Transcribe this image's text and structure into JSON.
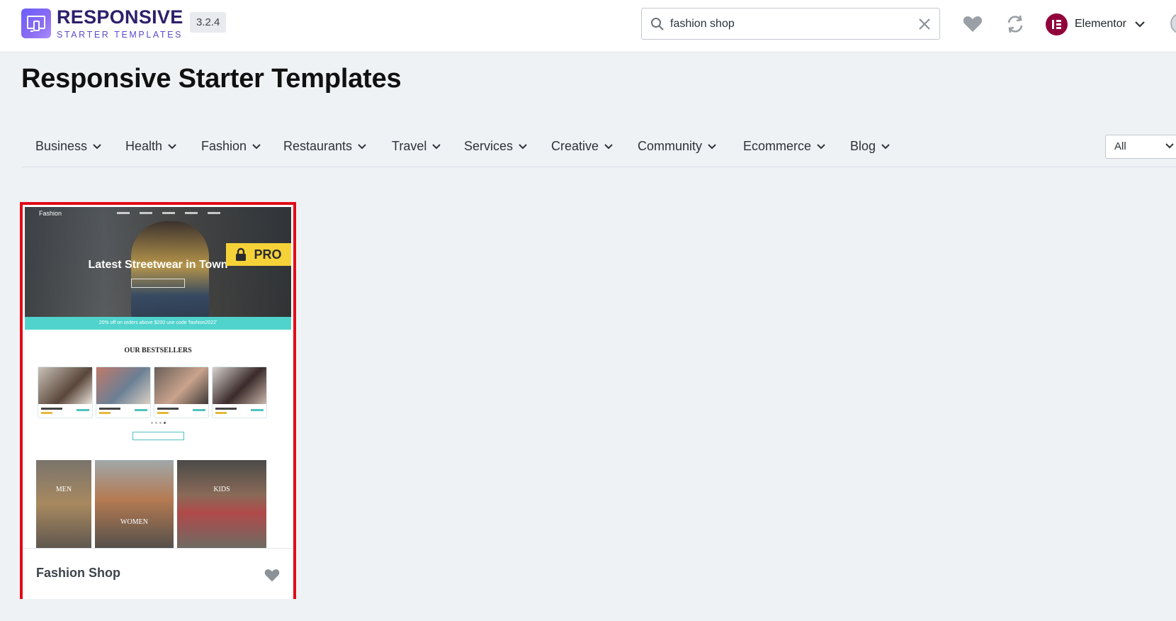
{
  "header": {
    "brand_main": "RESPONSIVE",
    "brand_sub": "STARTER TEMPLATES",
    "version": "3.2.4",
    "search_value": "fashion shop",
    "builder_name": "Elementor"
  },
  "page_title": "Responsive Starter Templates",
  "categories": [
    "Business",
    "Health",
    "Fashion",
    "Restaurants",
    "Travel",
    "Services",
    "Creative",
    "Community",
    "Ecommerce",
    "Blog"
  ],
  "filter": {
    "selected": "All"
  },
  "templates": [
    {
      "title": "Fashion Shop",
      "badge": "PRO",
      "preview": {
        "site_logo": "Fashion",
        "headline": "Latest Streetwear in Town",
        "promo": "20% off on orders above $200 use code 'fashion2022'",
        "section_title": "OUR BESTSELLERS",
        "tiles": [
          "MEN",
          "WOMEN",
          "KIDS"
        ]
      }
    }
  ],
  "colors": {
    "brand_gradient_start": "#6a5cff",
    "brand_text": "#2d1f6b",
    "elementor_badge": "#92003b",
    "pro_badge": "#f6d239",
    "selection_border": "#e10b17",
    "promo_teal": "#4fd3cc"
  },
  "icons": [
    "search-icon",
    "clear-icon",
    "heart-icon",
    "sync-icon",
    "elementor-logo-icon",
    "chevron-down-icon",
    "lock-icon"
  ]
}
